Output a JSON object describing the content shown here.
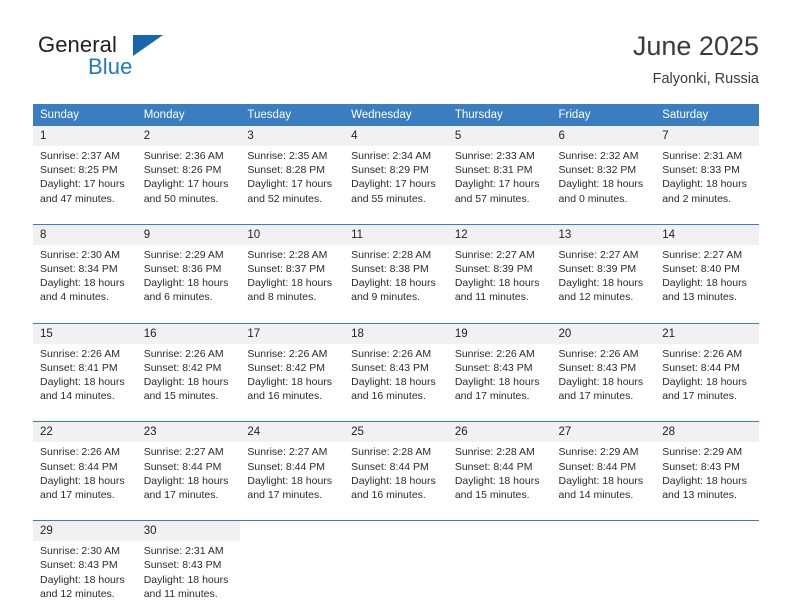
{
  "brand": {
    "name_part1": "General",
    "name_part2": "Blue",
    "triangle_color": "#1667ae",
    "blue_color": "#2179c0"
  },
  "header": {
    "title": "June 2025",
    "location": "Falyonki, Russia"
  },
  "theme": {
    "header_bg": "#3a7dc0",
    "daynum_bg": "#f1f1f1",
    "text": "#222222"
  },
  "weekday_headers": [
    "Sunday",
    "Monday",
    "Tuesday",
    "Wednesday",
    "Thursday",
    "Friday",
    "Saturday"
  ],
  "weeks": [
    [
      {
        "day": "1",
        "sunrise": "Sunrise: 2:37 AM",
        "sunset": "Sunset: 8:25 PM",
        "daylight1": "Daylight: 17 hours",
        "daylight2": "and 47 minutes."
      },
      {
        "day": "2",
        "sunrise": "Sunrise: 2:36 AM",
        "sunset": "Sunset: 8:26 PM",
        "daylight1": "Daylight: 17 hours",
        "daylight2": "and 50 minutes."
      },
      {
        "day": "3",
        "sunrise": "Sunrise: 2:35 AM",
        "sunset": "Sunset: 8:28 PM",
        "daylight1": "Daylight: 17 hours",
        "daylight2": "and 52 minutes."
      },
      {
        "day": "4",
        "sunrise": "Sunrise: 2:34 AM",
        "sunset": "Sunset: 8:29 PM",
        "daylight1": "Daylight: 17 hours",
        "daylight2": "and 55 minutes."
      },
      {
        "day": "5",
        "sunrise": "Sunrise: 2:33 AM",
        "sunset": "Sunset: 8:31 PM",
        "daylight1": "Daylight: 17 hours",
        "daylight2": "and 57 minutes."
      },
      {
        "day": "6",
        "sunrise": "Sunrise: 2:32 AM",
        "sunset": "Sunset: 8:32 PM",
        "daylight1": "Daylight: 18 hours",
        "daylight2": "and 0 minutes."
      },
      {
        "day": "7",
        "sunrise": "Sunrise: 2:31 AM",
        "sunset": "Sunset: 8:33 PM",
        "daylight1": "Daylight: 18 hours",
        "daylight2": "and 2 minutes."
      }
    ],
    [
      {
        "day": "8",
        "sunrise": "Sunrise: 2:30 AM",
        "sunset": "Sunset: 8:34 PM",
        "daylight1": "Daylight: 18 hours",
        "daylight2": "and 4 minutes."
      },
      {
        "day": "9",
        "sunrise": "Sunrise: 2:29 AM",
        "sunset": "Sunset: 8:36 PM",
        "daylight1": "Daylight: 18 hours",
        "daylight2": "and 6 minutes."
      },
      {
        "day": "10",
        "sunrise": "Sunrise: 2:28 AM",
        "sunset": "Sunset: 8:37 PM",
        "daylight1": "Daylight: 18 hours",
        "daylight2": "and 8 minutes."
      },
      {
        "day": "11",
        "sunrise": "Sunrise: 2:28 AM",
        "sunset": "Sunset: 8:38 PM",
        "daylight1": "Daylight: 18 hours",
        "daylight2": "and 9 minutes."
      },
      {
        "day": "12",
        "sunrise": "Sunrise: 2:27 AM",
        "sunset": "Sunset: 8:39 PM",
        "daylight1": "Daylight: 18 hours",
        "daylight2": "and 11 minutes."
      },
      {
        "day": "13",
        "sunrise": "Sunrise: 2:27 AM",
        "sunset": "Sunset: 8:39 PM",
        "daylight1": "Daylight: 18 hours",
        "daylight2": "and 12 minutes."
      },
      {
        "day": "14",
        "sunrise": "Sunrise: 2:27 AM",
        "sunset": "Sunset: 8:40 PM",
        "daylight1": "Daylight: 18 hours",
        "daylight2": "and 13 minutes."
      }
    ],
    [
      {
        "day": "15",
        "sunrise": "Sunrise: 2:26 AM",
        "sunset": "Sunset: 8:41 PM",
        "daylight1": "Daylight: 18 hours",
        "daylight2": "and 14 minutes."
      },
      {
        "day": "16",
        "sunrise": "Sunrise: 2:26 AM",
        "sunset": "Sunset: 8:42 PM",
        "daylight1": "Daylight: 18 hours",
        "daylight2": "and 15 minutes."
      },
      {
        "day": "17",
        "sunrise": "Sunrise: 2:26 AM",
        "sunset": "Sunset: 8:42 PM",
        "daylight1": "Daylight: 18 hours",
        "daylight2": "and 16 minutes."
      },
      {
        "day": "18",
        "sunrise": "Sunrise: 2:26 AM",
        "sunset": "Sunset: 8:43 PM",
        "daylight1": "Daylight: 18 hours",
        "daylight2": "and 16 minutes."
      },
      {
        "day": "19",
        "sunrise": "Sunrise: 2:26 AM",
        "sunset": "Sunset: 8:43 PM",
        "daylight1": "Daylight: 18 hours",
        "daylight2": "and 17 minutes."
      },
      {
        "day": "20",
        "sunrise": "Sunrise: 2:26 AM",
        "sunset": "Sunset: 8:43 PM",
        "daylight1": "Daylight: 18 hours",
        "daylight2": "and 17 minutes."
      },
      {
        "day": "21",
        "sunrise": "Sunrise: 2:26 AM",
        "sunset": "Sunset: 8:44 PM",
        "daylight1": "Daylight: 18 hours",
        "daylight2": "and 17 minutes."
      }
    ],
    [
      {
        "day": "22",
        "sunrise": "Sunrise: 2:26 AM",
        "sunset": "Sunset: 8:44 PM",
        "daylight1": "Daylight: 18 hours",
        "daylight2": "and 17 minutes."
      },
      {
        "day": "23",
        "sunrise": "Sunrise: 2:27 AM",
        "sunset": "Sunset: 8:44 PM",
        "daylight1": "Daylight: 18 hours",
        "daylight2": "and 17 minutes."
      },
      {
        "day": "24",
        "sunrise": "Sunrise: 2:27 AM",
        "sunset": "Sunset: 8:44 PM",
        "daylight1": "Daylight: 18 hours",
        "daylight2": "and 17 minutes."
      },
      {
        "day": "25",
        "sunrise": "Sunrise: 2:28 AM",
        "sunset": "Sunset: 8:44 PM",
        "daylight1": "Daylight: 18 hours",
        "daylight2": "and 16 minutes."
      },
      {
        "day": "26",
        "sunrise": "Sunrise: 2:28 AM",
        "sunset": "Sunset: 8:44 PM",
        "daylight1": "Daylight: 18 hours",
        "daylight2": "and 15 minutes."
      },
      {
        "day": "27",
        "sunrise": "Sunrise: 2:29 AM",
        "sunset": "Sunset: 8:44 PM",
        "daylight1": "Daylight: 18 hours",
        "daylight2": "and 14 minutes."
      },
      {
        "day": "28",
        "sunrise": "Sunrise: 2:29 AM",
        "sunset": "Sunset: 8:43 PM",
        "daylight1": "Daylight: 18 hours",
        "daylight2": "and 13 minutes."
      }
    ],
    [
      {
        "day": "29",
        "sunrise": "Sunrise: 2:30 AM",
        "sunset": "Sunset: 8:43 PM",
        "daylight1": "Daylight: 18 hours",
        "daylight2": "and 12 minutes."
      },
      {
        "day": "30",
        "sunrise": "Sunrise: 2:31 AM",
        "sunset": "Sunset: 8:43 PM",
        "daylight1": "Daylight: 18 hours",
        "daylight2": "and 11 minutes."
      },
      {
        "day": "",
        "sunrise": "",
        "sunset": "",
        "daylight1": "",
        "daylight2": ""
      },
      {
        "day": "",
        "sunrise": "",
        "sunset": "",
        "daylight1": "",
        "daylight2": ""
      },
      {
        "day": "",
        "sunrise": "",
        "sunset": "",
        "daylight1": "",
        "daylight2": ""
      },
      {
        "day": "",
        "sunrise": "",
        "sunset": "",
        "daylight1": "",
        "daylight2": ""
      },
      {
        "day": "",
        "sunrise": "",
        "sunset": "",
        "daylight1": "",
        "daylight2": ""
      }
    ]
  ]
}
